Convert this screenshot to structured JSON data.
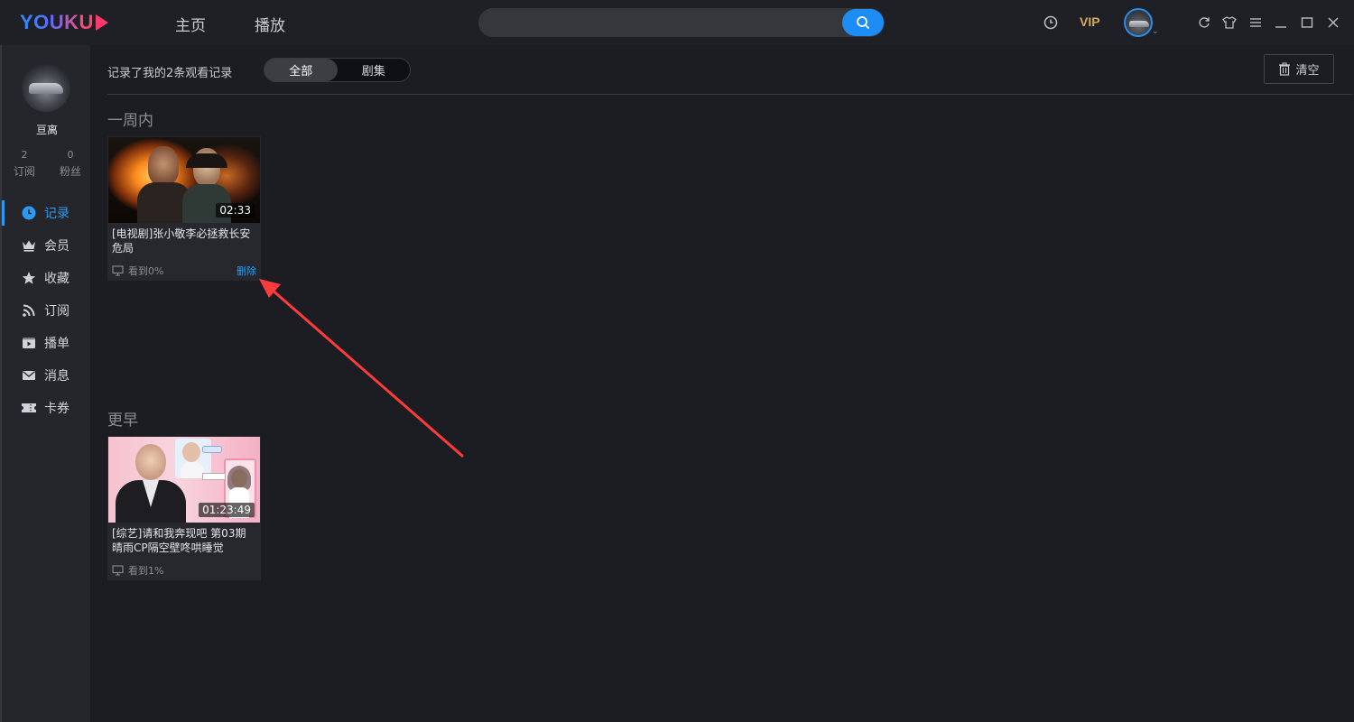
{
  "app": {
    "logo": "YOUKU",
    "nav": [
      "主页",
      "播放"
    ],
    "search": {
      "placeholder": ""
    },
    "vip": "VIP"
  },
  "sidebar": {
    "username": "亘离",
    "stats": [
      {
        "value": "2",
        "label": "订阅"
      },
      {
        "value": "0",
        "label": "粉丝"
      }
    ],
    "items": [
      {
        "label": "记录",
        "icon": "clock-icon",
        "active": true
      },
      {
        "label": "会员",
        "icon": "crown-icon"
      },
      {
        "label": "收藏",
        "icon": "star-icon"
      },
      {
        "label": "订阅",
        "icon": "rss-icon"
      },
      {
        "label": "播单",
        "icon": "playlist-icon"
      },
      {
        "label": "消息",
        "icon": "mail-icon"
      },
      {
        "label": "卡券",
        "icon": "ticket-icon"
      }
    ]
  },
  "main": {
    "summary": "记录了我的2条观看记录",
    "tabs": [
      "全部",
      "剧集"
    ],
    "clear_label": "清空",
    "sections": [
      {
        "title": "一周内",
        "items": [
          {
            "duration": "02:33",
            "title": "[电视剧]张小敬李必拯救长安危局",
            "progress": "看到0%",
            "delete": "删除"
          }
        ]
      },
      {
        "title": "更早",
        "items": [
          {
            "duration": "01:23:49",
            "title": "[综艺]请和我奔现吧 第03期 晴雨CP隔空壁咚哄睡觉",
            "progress": "看到1%"
          }
        ]
      }
    ]
  },
  "colors": {
    "accent": "#2b9af3",
    "vip": "#d6a85a",
    "annotation": "#ff3b3b"
  }
}
